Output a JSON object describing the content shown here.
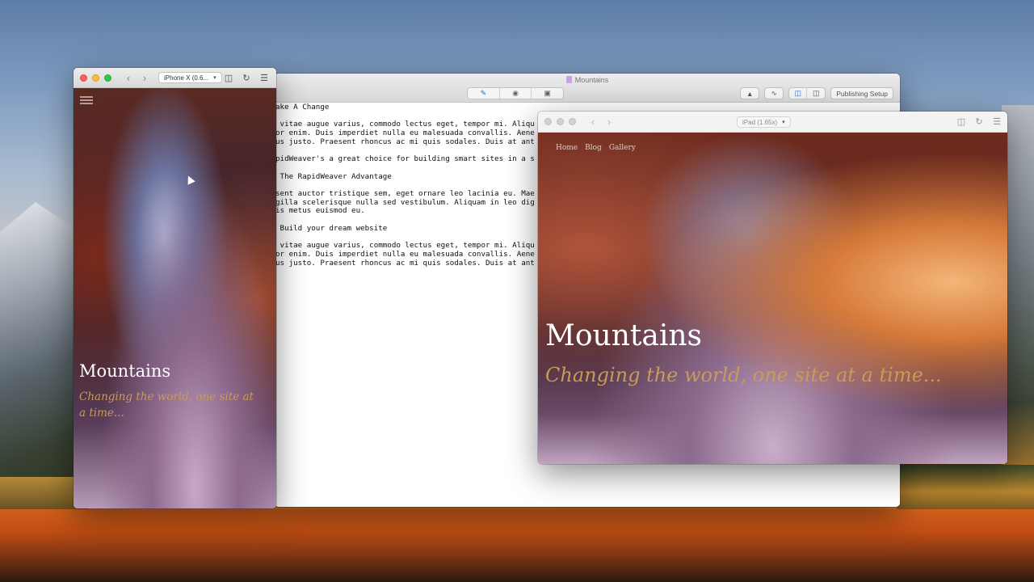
{
  "editor": {
    "title": "Mountains",
    "toolbar": {
      "modes": [
        "edit",
        "preview",
        "publish"
      ],
      "publishing_setup_label": "Publishing Setup"
    },
    "lines": [
      "ake A Change",
      "",
      " vitae augue varius, commodo lectus eget, tempor mi. Aliqu",
      "or enim. Duis imperdiet nulla eu malesuada convallis. Aene",
      "us justo. Praesent rhoncus ac mi quis sodales. Duis at ant",
      "",
      "pidWeaver's a great choice for building smart sites in a s",
      "",
      " The RapidWeaver Advantage",
      "",
      "sent auctor tristique sem, eget ornare leo lacinia eu. Mae",
      "gilla scelerisque nulla sed vestibulum. Aliquam in leo dig",
      "is metus euismod eu.",
      "",
      " Build your dream website",
      "",
      " vitae augue varius, commodo lectus eget, tempor mi. Aliqu",
      "or enim. Duis imperdiet nulla eu malesuada convallis. Aene",
      "us justo. Praesent rhoncus ac mi quis sodales. Duis at ant"
    ]
  },
  "iphone_preview": {
    "device_label": "iPhone X (0.6...",
    "site_title": "Mountains",
    "tagline": "Changing the world, one site at a time..."
  },
  "ipad_preview": {
    "device_label": "iPad (1.65x)",
    "nav": [
      "Home",
      "Blog",
      "Gallery"
    ],
    "site_title": "Mountains",
    "tagline": "Changing the world, one site at a time..."
  },
  "colors": {
    "tagline": "#c99a5a",
    "accent": "#2d6fd6",
    "close": "#fc605b",
    "minimize": "#fdbc40",
    "maximize": "#34c84a"
  }
}
